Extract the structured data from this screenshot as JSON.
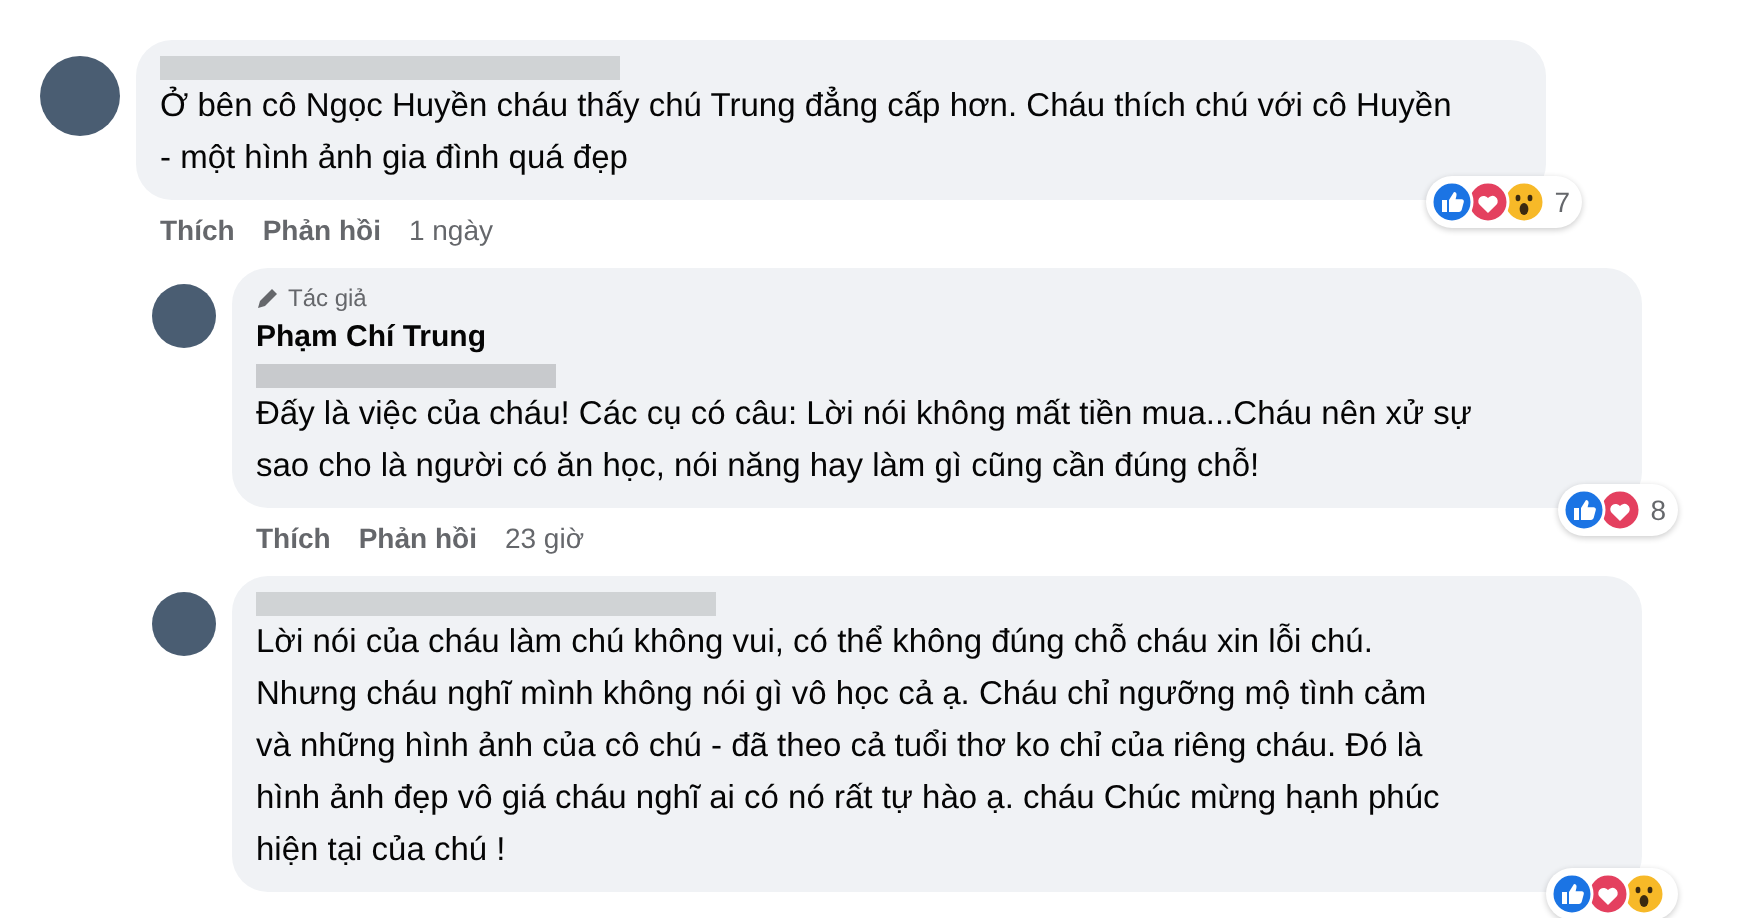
{
  "comments": [
    {
      "lines": [
        "Ở bên cô Ngọc Huyền cháu thấy chú Trung đẳng cấp hơn. Cháu thích chú với cô Huyền",
        "- một hình ảnh gia đình quá đẹp"
      ],
      "reactions": [
        {
          "kind": "like"
        },
        {
          "kind": "love"
        },
        {
          "kind": "wow"
        }
      ],
      "reaction_count": "7",
      "actions": [
        "Thích",
        "Phản hồi"
      ],
      "time": "1 ngày",
      "children": [
        {
          "badge": "Tác giả",
          "name": "Phạm Chí Trung",
          "mention_hidden": true,
          "lines": [
            "Đấy là việc của cháu! Các cụ có câu: Lời nói không mất tiền mua...Cháu nên xử sự",
            "sao cho là người có ăn học, nói năng hay làm gì cũng cần đúng chỗ!"
          ],
          "reactions": [
            {
              "kind": "like"
            },
            {
              "kind": "love"
            }
          ],
          "reaction_count": "8",
          "actions": [
            "Thích",
            "Phản hồi"
          ],
          "time": "23 giờ"
        },
        {
          "lines": [
            "Lời nói của cháu làm chú không vui, có thể không đúng chỗ cháu xin lỗi chú.",
            "Nhưng cháu nghĩ mình không nói gì vô học cả ạ. Cháu chỉ ngưỡng mộ tình cảm",
            "và những hình ảnh của cô chú - đã theo cả tuổi thơ ko chỉ của riêng cháu. Đó là",
            "hình ảnh đẹp vô giá cháu nghĩ ai có nó rất tự hào ạ. cháu Chúc mừng hạnh phúc",
            "hiện tại của chú !"
          ],
          "reactions": [
            {
              "kind": "like"
            },
            {
              "kind": "love"
            },
            {
              "kind": "wow"
            }
          ]
        }
      ]
    }
  ]
}
